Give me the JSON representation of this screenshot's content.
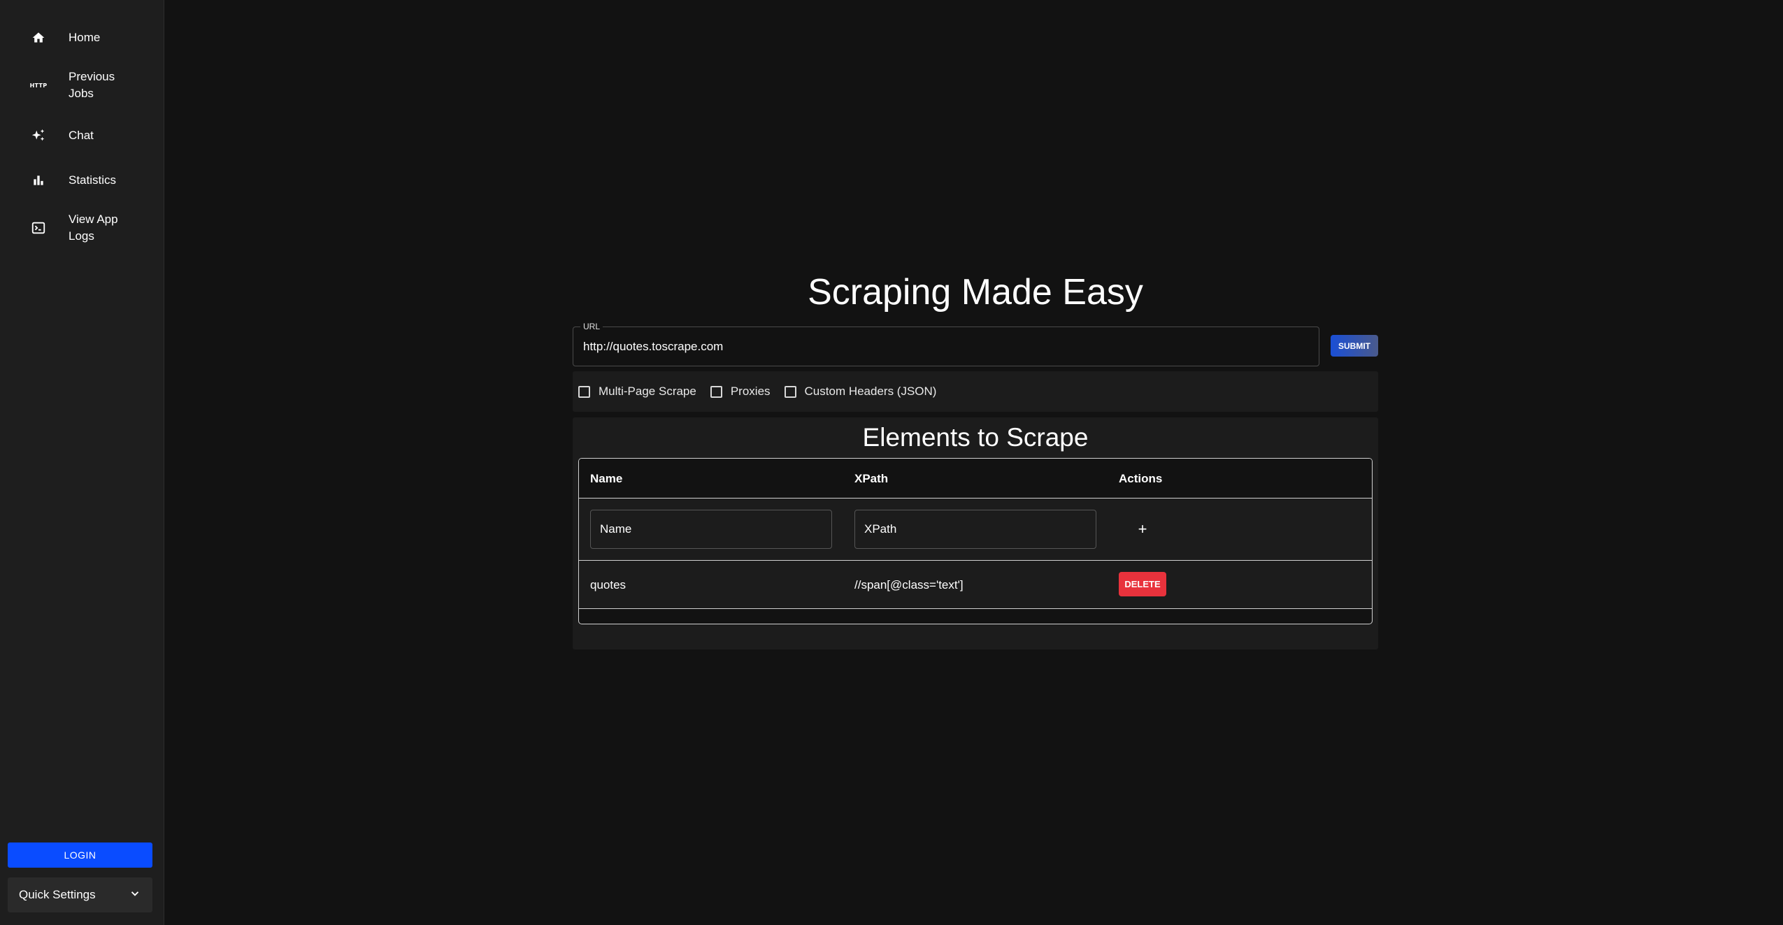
{
  "sidebar": {
    "items": [
      {
        "label": "Home",
        "icon": "home-icon"
      },
      {
        "label": "Previous Jobs",
        "icon": "http-icon"
      },
      {
        "label": "Chat",
        "icon": "sparkle-icon"
      },
      {
        "label": "Statistics",
        "icon": "bar-chart-icon"
      },
      {
        "label": "View App Logs",
        "icon": "terminal-icon"
      }
    ],
    "http_icon_text": "HTTP",
    "login_label": "LOGIN",
    "quick_settings_label": "Quick Settings"
  },
  "main": {
    "title": "Scraping Made Easy",
    "url_label": "URL",
    "url_value": "http://quotes.toscrape.com",
    "submit_label": "SUBMIT",
    "options": [
      {
        "label": "Multi-Page Scrape",
        "checked": false
      },
      {
        "label": "Proxies",
        "checked": false
      },
      {
        "label": "Custom Headers (JSON)",
        "checked": false
      }
    ],
    "elements": {
      "title": "Elements to Scrape",
      "columns": [
        "Name",
        "XPath",
        "Actions"
      ],
      "name_placeholder": "Name",
      "xpath_placeholder": "XPath",
      "add_label": "+",
      "rows": [
        {
          "name": "quotes",
          "xpath": "//span[@class='text']",
          "action_label": "DELETE"
        }
      ]
    }
  },
  "colors": {
    "background": "#121212",
    "sidebar": "#1e1e1e",
    "login": "#0a4cff",
    "delete": "#e8323c"
  }
}
